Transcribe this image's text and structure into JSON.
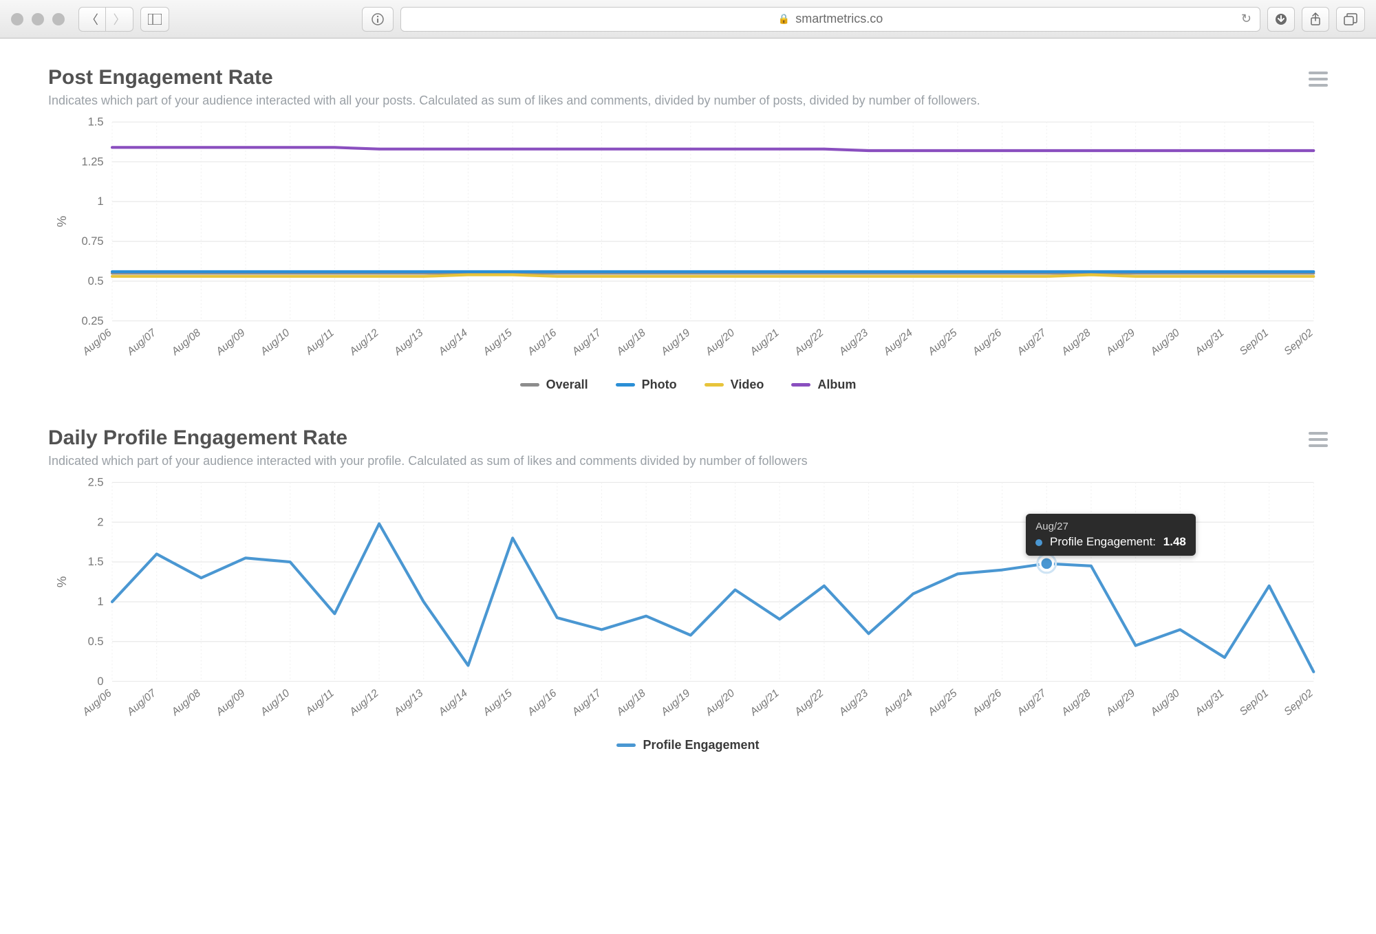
{
  "browser": {
    "url_display": "smartmetrics.co"
  },
  "chart1": {
    "title": "Post Engagement Rate",
    "subtitle": "Indicates which part of your audience interacted with all your posts. Calculated as sum of likes and comments, divided by number of posts, divided by number of followers.",
    "ylabel": "%",
    "legend": {
      "overall": "Overall",
      "photo": "Photo",
      "video": "Video",
      "album": "Album"
    }
  },
  "chart2": {
    "title": "Daily Profile Engagement Rate",
    "subtitle": "Indicated which part of your audience interacted with your profile. Calculated as sum of likes and comments divided by number of followers",
    "ylabel": "%",
    "legend": {
      "profile": "Profile Engagement"
    },
    "tooltip": {
      "date": "Aug/27",
      "label": "Profile Engagement:",
      "value": "1.48"
    }
  },
  "chart_data": [
    {
      "type": "line",
      "title": "Post Engagement Rate",
      "ylabel": "%",
      "ylim": [
        0.25,
        1.5
      ],
      "yticks": [
        0.25,
        0.5,
        0.75,
        1,
        1.25,
        1.5
      ],
      "categories": [
        "Aug/06",
        "Aug/07",
        "Aug/08",
        "Aug/09",
        "Aug/10",
        "Aug/11",
        "Aug/12",
        "Aug/13",
        "Aug/14",
        "Aug/15",
        "Aug/16",
        "Aug/17",
        "Aug/18",
        "Aug/19",
        "Aug/20",
        "Aug/21",
        "Aug/22",
        "Aug/23",
        "Aug/24",
        "Aug/25",
        "Aug/26",
        "Aug/27",
        "Aug/28",
        "Aug/29",
        "Aug/30",
        "Aug/31",
        "Sep/01",
        "Sep/02"
      ],
      "series": [
        {
          "name": "Overall",
          "color": "#8d8d8d",
          "values": [
            0.55,
            0.55,
            0.55,
            0.55,
            0.55,
            0.55,
            0.55,
            0.55,
            0.55,
            0.55,
            0.55,
            0.55,
            0.55,
            0.55,
            0.55,
            0.55,
            0.55,
            0.55,
            0.55,
            0.55,
            0.55,
            0.55,
            0.55,
            0.55,
            0.55,
            0.55,
            0.55,
            0.55
          ]
        },
        {
          "name": "Photo",
          "color": "#2b8fd6",
          "values": [
            0.56,
            0.56,
            0.56,
            0.56,
            0.56,
            0.56,
            0.56,
            0.56,
            0.56,
            0.56,
            0.56,
            0.56,
            0.56,
            0.56,
            0.56,
            0.56,
            0.56,
            0.56,
            0.56,
            0.56,
            0.56,
            0.56,
            0.56,
            0.56,
            0.56,
            0.56,
            0.56,
            0.56
          ]
        },
        {
          "name": "Video",
          "color": "#e7c43b",
          "values": [
            0.53,
            0.53,
            0.53,
            0.53,
            0.53,
            0.53,
            0.53,
            0.53,
            0.54,
            0.54,
            0.53,
            0.53,
            0.53,
            0.53,
            0.53,
            0.53,
            0.53,
            0.53,
            0.53,
            0.53,
            0.53,
            0.53,
            0.54,
            0.53,
            0.53,
            0.53,
            0.53,
            0.53
          ]
        },
        {
          "name": "Album",
          "color": "#8a4fbf",
          "values": [
            1.34,
            1.34,
            1.34,
            1.34,
            1.34,
            1.34,
            1.33,
            1.33,
            1.33,
            1.33,
            1.33,
            1.33,
            1.33,
            1.33,
            1.33,
            1.33,
            1.33,
            1.32,
            1.32,
            1.32,
            1.32,
            1.32,
            1.32,
            1.32,
            1.32,
            1.32,
            1.32,
            1.32
          ]
        }
      ]
    },
    {
      "type": "line",
      "title": "Daily Profile Engagement Rate",
      "ylabel": "%",
      "ylim": [
        0,
        2.5
      ],
      "yticks": [
        0,
        0.5,
        1,
        1.5,
        2,
        2.5
      ],
      "categories": [
        "Aug/06",
        "Aug/07",
        "Aug/08",
        "Aug/09",
        "Aug/10",
        "Aug/11",
        "Aug/12",
        "Aug/13",
        "Aug/14",
        "Aug/15",
        "Aug/16",
        "Aug/17",
        "Aug/18",
        "Aug/19",
        "Aug/20",
        "Aug/21",
        "Aug/22",
        "Aug/23",
        "Aug/24",
        "Aug/25",
        "Aug/26",
        "Aug/27",
        "Aug/28",
        "Aug/29",
        "Aug/30",
        "Aug/31",
        "Sep/01",
        "Sep/02"
      ],
      "series": [
        {
          "name": "Profile Engagement",
          "color": "#4a97d2",
          "values": [
            1.0,
            1.6,
            1.3,
            1.55,
            1.5,
            0.85,
            1.98,
            1.0,
            0.2,
            1.8,
            0.8,
            0.65,
            0.82,
            0.58,
            1.15,
            0.78,
            1.2,
            0.6,
            1.1,
            1.35,
            1.4,
            1.48,
            1.45,
            0.45,
            0.65,
            0.3,
            1.2,
            0.12
          ]
        }
      ],
      "highlight": {
        "x": "Aug/27",
        "series": "Profile Engagement",
        "value": 1.48
      }
    }
  ]
}
